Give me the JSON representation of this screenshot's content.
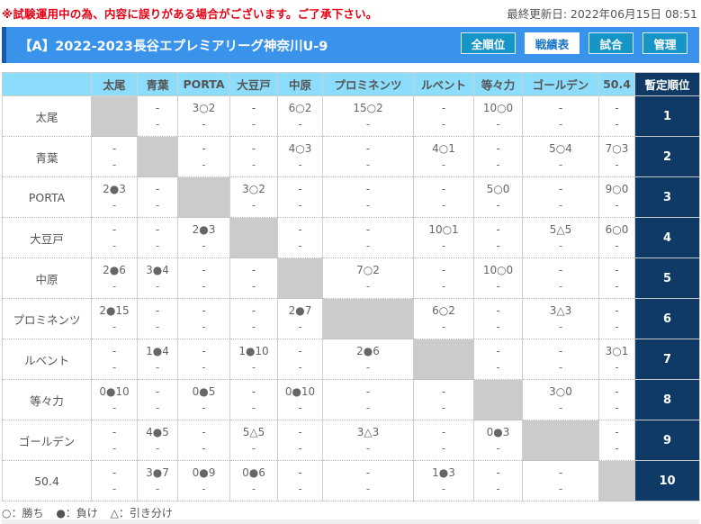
{
  "notice": "※試験運用中の為、内容に誤りがある場合がございます。ご了承下さい。",
  "last_updated": "最終更新日: 2022年06月15日 08:51",
  "header": {
    "title": "【A】2022-2023長谷エプレミアリーグ神奈川U-9",
    "nav": [
      {
        "label": "全順位",
        "active": false
      },
      {
        "label": "戦績表",
        "active": true
      },
      {
        "label": "試合",
        "active": false
      },
      {
        "label": "管理",
        "active": false
      }
    ]
  },
  "table": {
    "rank_header": "暫定順位",
    "columns": [
      "太尾",
      "青葉",
      "PORTA",
      "大豆戸",
      "中原",
      "プロミネンツ",
      "ルベント",
      "等々力",
      "ゴールデン",
      "50.4"
    ],
    "rows": [
      {
        "team": "太尾",
        "rank": "1",
        "cells": [
          null,
          [
            "-",
            "-"
          ],
          [
            "3○2",
            "-"
          ],
          [
            "-",
            "-"
          ],
          [
            "6○2",
            "-"
          ],
          [
            "15○2",
            "-"
          ],
          [
            "-",
            "-"
          ],
          [
            "10○0",
            "-"
          ],
          [
            "-",
            "-"
          ],
          [
            "-",
            "-"
          ]
        ]
      },
      {
        "team": "青葉",
        "rank": "2",
        "cells": [
          [
            "-",
            "-"
          ],
          null,
          [
            "-",
            "-"
          ],
          [
            "-",
            "-"
          ],
          [
            "4○3",
            "-"
          ],
          [
            "-",
            "-"
          ],
          [
            "4○1",
            "-"
          ],
          [
            "-",
            "-"
          ],
          [
            "5○4",
            "-"
          ],
          [
            "7○3",
            "-"
          ]
        ]
      },
      {
        "team": "PORTA",
        "rank": "3",
        "cells": [
          [
            "2●3",
            "-"
          ],
          [
            "-",
            "-"
          ],
          null,
          [
            "3○2",
            "-"
          ],
          [
            "-",
            "-"
          ],
          [
            "-",
            "-"
          ],
          [
            "-",
            "-"
          ],
          [
            "5○0",
            "-"
          ],
          [
            "-",
            "-"
          ],
          [
            "9○0",
            "-"
          ]
        ]
      },
      {
        "team": "大豆戸",
        "rank": "4",
        "cells": [
          [
            "-",
            "-"
          ],
          [
            "-",
            "-"
          ],
          [
            "2●3",
            "-"
          ],
          null,
          [
            "-",
            "-"
          ],
          [
            "-",
            "-"
          ],
          [
            "10○1",
            "-"
          ],
          [
            "-",
            "-"
          ],
          [
            "5△5",
            "-"
          ],
          [
            "6○0",
            "-"
          ]
        ]
      },
      {
        "team": "中原",
        "rank": "5",
        "cells": [
          [
            "2●6",
            "-"
          ],
          [
            "3●4",
            "-"
          ],
          [
            "-",
            "-"
          ],
          [
            "-",
            "-"
          ],
          null,
          [
            "7○2",
            "-"
          ],
          [
            "-",
            "-"
          ],
          [
            "10○0",
            "-"
          ],
          [
            "-",
            "-"
          ],
          [
            "-",
            "-"
          ]
        ]
      },
      {
        "team": "プロミネンツ",
        "rank": "6",
        "cells": [
          [
            "2●15",
            "-"
          ],
          [
            "-",
            "-"
          ],
          [
            "-",
            "-"
          ],
          [
            "-",
            "-"
          ],
          [
            "2●7",
            "-"
          ],
          null,
          [
            "6○2",
            "-"
          ],
          [
            "-",
            "-"
          ],
          [
            "3△3",
            "-"
          ],
          [
            "-",
            "-"
          ]
        ]
      },
      {
        "team": "ルベント",
        "rank": "7",
        "cells": [
          [
            "-",
            "-"
          ],
          [
            "1●4",
            "-"
          ],
          [
            "-",
            "-"
          ],
          [
            "1●10",
            "-"
          ],
          [
            "-",
            "-"
          ],
          [
            "2●6",
            "-"
          ],
          null,
          [
            "-",
            "-"
          ],
          [
            "-",
            "-"
          ],
          [
            "3○1",
            "-"
          ]
        ]
      },
      {
        "team": "等々力",
        "rank": "8",
        "cells": [
          [
            "0●10",
            "-"
          ],
          [
            "-",
            "-"
          ],
          [
            "0●5",
            "-"
          ],
          [
            "-",
            "-"
          ],
          [
            "0●10",
            "-"
          ],
          [
            "-",
            "-"
          ],
          [
            "-",
            "-"
          ],
          null,
          [
            "3○0",
            "-"
          ],
          [
            "-",
            "-"
          ]
        ]
      },
      {
        "team": "ゴールデン",
        "rank": "9",
        "cells": [
          [
            "-",
            "-"
          ],
          [
            "4●5",
            "-"
          ],
          [
            "-",
            "-"
          ],
          [
            "5△5",
            "-"
          ],
          [
            "-",
            "-"
          ],
          [
            "3△3",
            "-"
          ],
          [
            "-",
            "-"
          ],
          [
            "0●3",
            "-"
          ],
          null,
          [
            "-",
            "-"
          ]
        ]
      },
      {
        "team": "50.4",
        "rank": "10",
        "cells": [
          [
            "-",
            "-"
          ],
          [
            "3●7",
            "-"
          ],
          [
            "0●9",
            "-"
          ],
          [
            "0●6",
            "-"
          ],
          [
            "-",
            "-"
          ],
          [
            "-",
            "-"
          ],
          [
            "1●3",
            "-"
          ],
          [
            "-",
            "-"
          ],
          [
            "-",
            "-"
          ],
          null
        ]
      }
    ]
  },
  "legend": {
    "win": "○：勝ち",
    "loss": "●：負け",
    "draw": "△：引き分け"
  }
}
